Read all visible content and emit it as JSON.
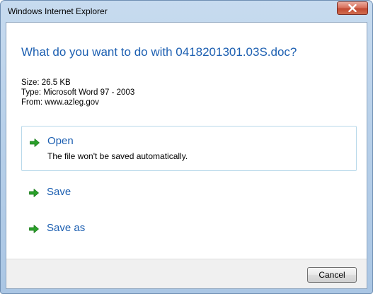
{
  "window": {
    "title": "Windows Internet Explorer",
    "close_icon": "close-x-icon"
  },
  "dialog": {
    "question": "What do you want to do with 0418201301.03S.doc?",
    "file_info": {
      "size": "Size: 26.5 KB",
      "type": "Type: Microsoft Word 97 - 2003",
      "from": "From: www.azleg.gov"
    },
    "options": [
      {
        "label": "Open",
        "description": "The file won't be saved automatically.",
        "icon": "green-arrow-icon"
      },
      {
        "label": "Save",
        "icon": "green-arrow-icon"
      },
      {
        "label": "Save as",
        "icon": "green-arrow-icon"
      }
    ],
    "cancel_label": "Cancel"
  },
  "colors": {
    "accent_blue": "#1c5fb1",
    "arrow_green": "#2aa02a",
    "close_red": "#c24a33"
  }
}
